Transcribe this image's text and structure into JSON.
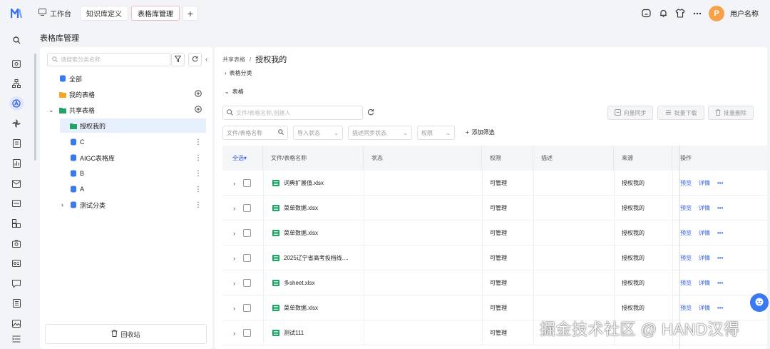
{
  "topbar": {
    "tabs": [
      {
        "label": "工作台"
      },
      {
        "label": "知识库定义"
      },
      {
        "label": "表格库管理"
      }
    ],
    "add_tab_label": "+",
    "avatar_initial": "P",
    "username": "用户名称",
    "accent_color": "#f7a24a"
  },
  "page": {
    "title": "表格库管理"
  },
  "tree": {
    "search_placeholder": "请搜索分类名称",
    "items": [
      {
        "label": "全部",
        "icon": "database-icon"
      },
      {
        "label": "我的表格",
        "icon": "folder-icon"
      },
      {
        "label": "共享表格",
        "icon": "share-folder-icon"
      },
      {
        "label": "授权我的",
        "icon": "folder-icon"
      },
      {
        "label": "C",
        "icon": "database-icon"
      },
      {
        "label": "AIGC表格库",
        "icon": "database-icon"
      },
      {
        "label": "B",
        "icon": "database-icon"
      },
      {
        "label": "A",
        "icon": "database-icon"
      },
      {
        "label": "测试分类",
        "icon": "database-icon"
      }
    ],
    "recycle_label": "回收站"
  },
  "main": {
    "breadcrumb": {
      "root": "共享表格",
      "separator": "/",
      "current": "授权我的"
    },
    "section_category": "表格分类",
    "section_table": "表格",
    "search_placeholder": "文件/表格名称,创建人",
    "actions": {
      "sync": "向量同步",
      "download": "批量下载",
      "delete": "批量删除"
    },
    "filters": [
      {
        "label": "文件/表格名称"
      },
      {
        "label": "导入状态"
      },
      {
        "label": "描述同步状态"
      },
      {
        "label": "权限"
      }
    ],
    "add_filter": "添加筛选",
    "columns": {
      "select_all": "全选",
      "name": "文件/表格名称",
      "status": "状态",
      "permission": "权限",
      "description": "描述",
      "source": "来源",
      "operation": "操作"
    },
    "rows": [
      {
        "name": "词典扩展值.xlsx",
        "status": "",
        "permission": "可管理",
        "description": "",
        "source": "授权我的",
        "preview": "预览",
        "detail": "详情",
        "more": "•••"
      },
      {
        "name": "菜单数据.xlsx",
        "status": "",
        "permission": "可管理",
        "description": "",
        "source": "授权我的",
        "preview": "预览",
        "detail": "详情",
        "more": "•••"
      },
      {
        "name": "菜单数据.xlsx",
        "status": "",
        "permission": "可管理",
        "description": "",
        "source": "授权我的",
        "preview": "预览",
        "detail": "详情",
        "more": "•••"
      },
      {
        "name": "2025辽宁省高考投档线....",
        "status": "",
        "permission": "可管理",
        "description": "",
        "source": "授权我的",
        "preview": "预览",
        "detail": "详情",
        "more": "•••"
      },
      {
        "name": "多sheet.xlsx",
        "status": "",
        "permission": "可管理",
        "description": "",
        "source": "授权我的",
        "preview": "预览",
        "detail": "详情",
        "more": "•••"
      },
      {
        "name": "菜单数据.xlsx",
        "status": "",
        "permission": "可管理",
        "description": "",
        "source": "授权我的",
        "preview": "预览",
        "detail": "详情",
        "more": "•••"
      },
      {
        "name": "测试111",
        "status": "",
        "permission": "可管理",
        "description": "",
        "source": "",
        "preview": "",
        "detail": "",
        "more": ""
      }
    ]
  },
  "watermark": "掘金技术社区 @ HAND汉得",
  "colors": {
    "link": "#2f5ce6",
    "selected_bg": "#e8effd",
    "excel_green": "#21a366"
  }
}
